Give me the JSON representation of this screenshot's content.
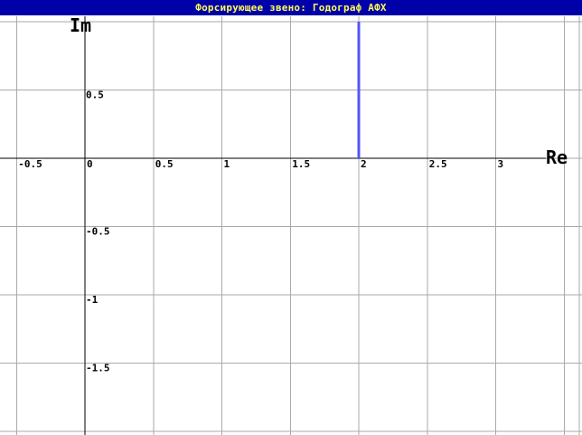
{
  "window": {
    "title": "Форсирующее звено: Годограф АФХ"
  },
  "colors": {
    "title_bar_bg": "#0000a8",
    "title_text": "#ffff54",
    "grid": "#aaaaaa",
    "axis": "#000000",
    "series": "#5454fc"
  },
  "chart_data": {
    "type": "line",
    "title": "Форсирующее звено: Годограф АФХ",
    "xlabel": "Re",
    "ylabel": "Im",
    "xlim": [
      -0.5,
      3.5
    ],
    "ylim": [
      -2.0,
      1.0
    ],
    "grid": true,
    "x_ticks": [
      {
        "value": -0.5,
        "label": "-0.5"
      },
      {
        "value": 0,
        "label": "0"
      },
      {
        "value": 0.5,
        "label": "0.5"
      },
      {
        "value": 1,
        "label": "1"
      },
      {
        "value": 1.5,
        "label": "1.5"
      },
      {
        "value": 2,
        "label": "2"
      },
      {
        "value": 2.5,
        "label": "2.5"
      },
      {
        "value": 3,
        "label": "3"
      }
    ],
    "y_ticks": [
      {
        "value": 0.5,
        "label": "0.5"
      },
      {
        "value": -0.5,
        "label": "-0.5"
      },
      {
        "value": -1,
        "label": "-1"
      },
      {
        "value": -1.5,
        "label": "-1.5"
      }
    ],
    "series": [
      {
        "x": [
          2,
          2
        ],
        "y": [
          0,
          1.0
        ]
      }
    ]
  }
}
